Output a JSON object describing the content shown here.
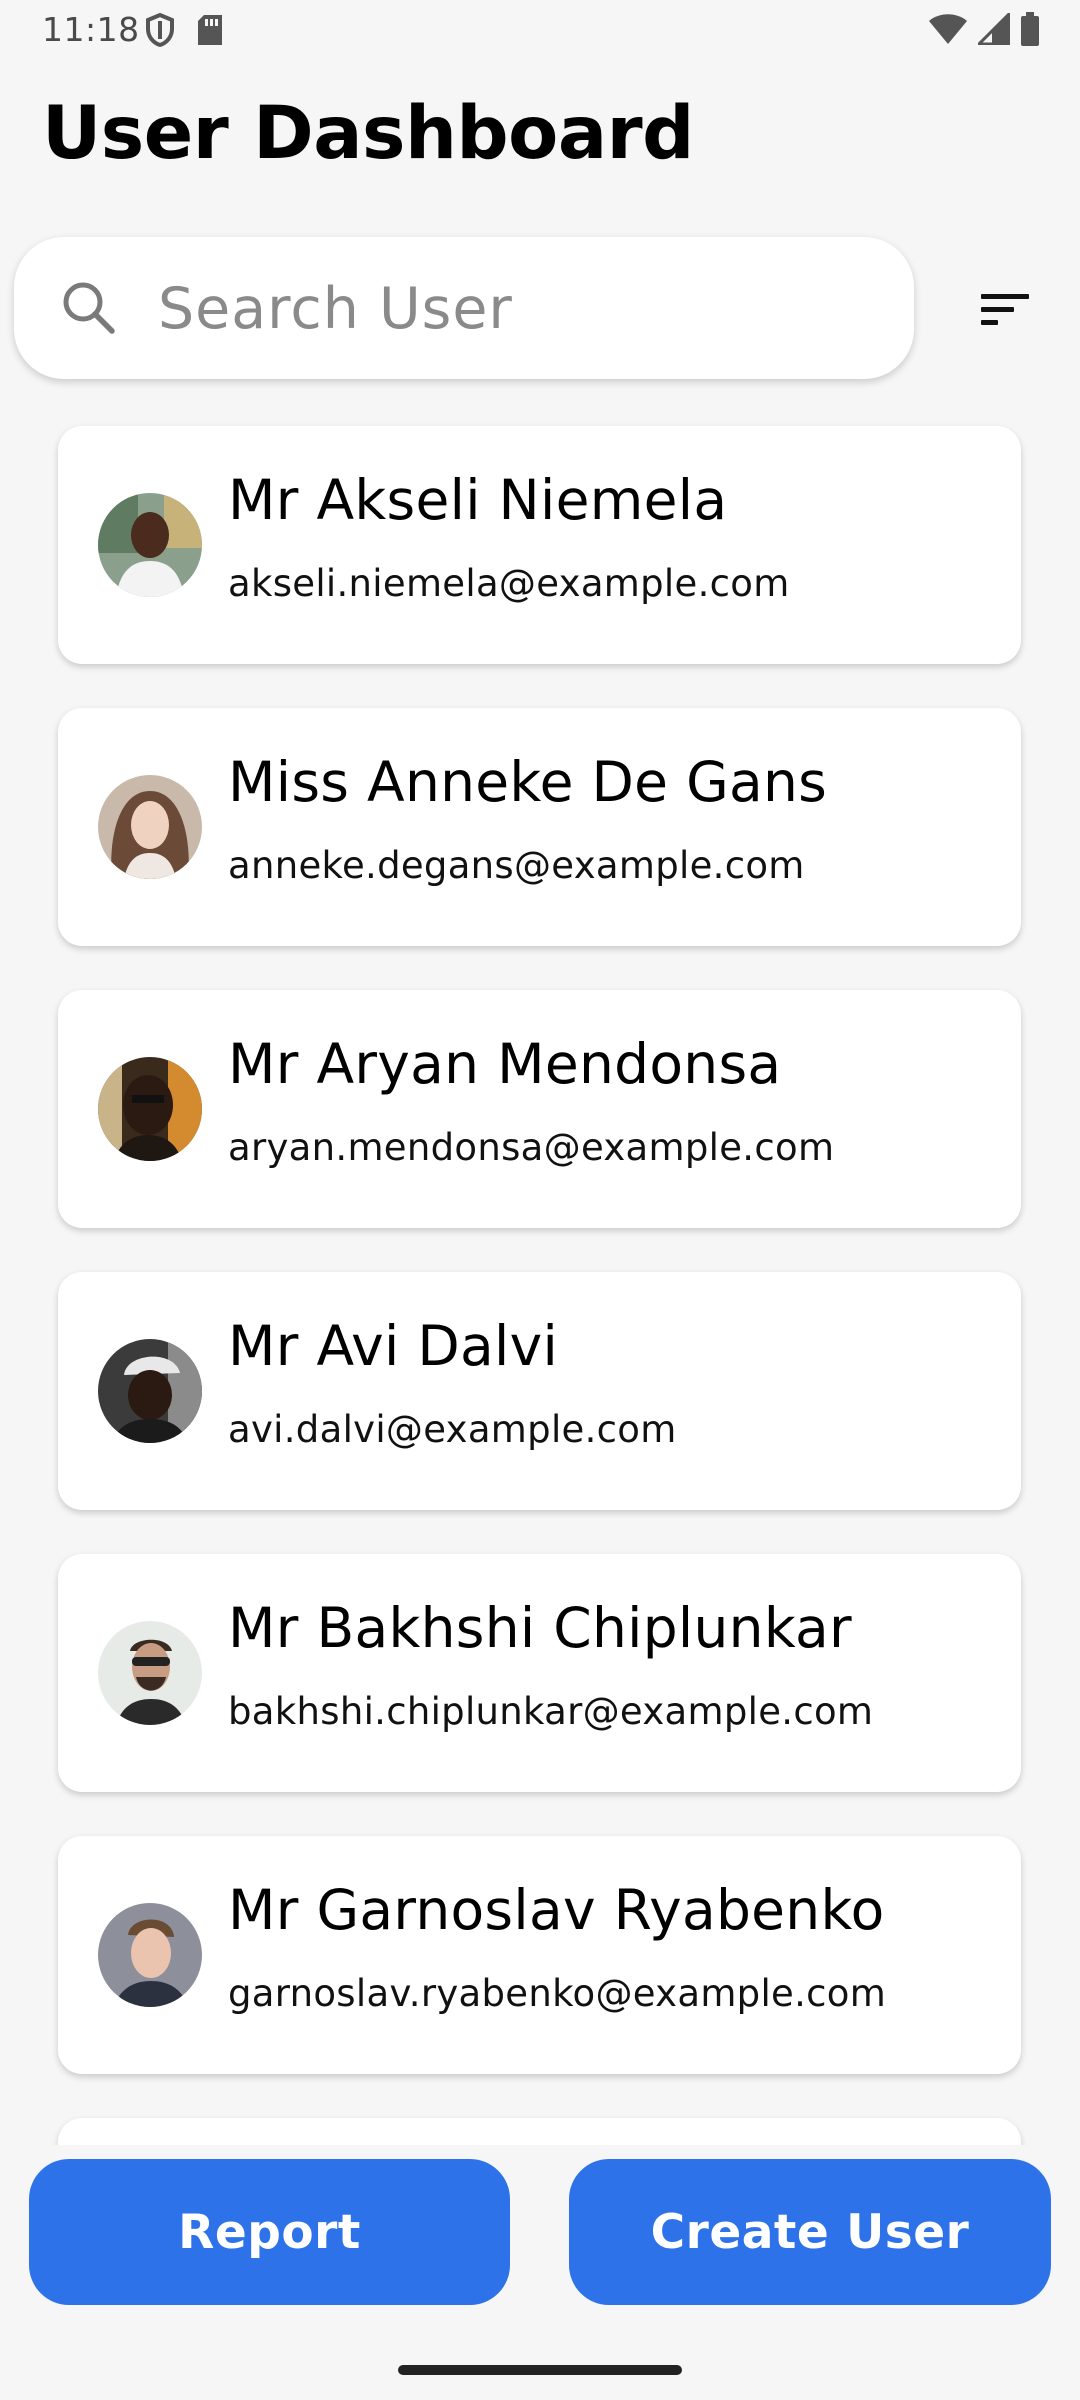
{
  "status_bar": {
    "time": "11:18",
    "left_icons": [
      "shield-icon",
      "sd-card-icon"
    ],
    "right_icons": [
      "wifi-icon",
      "signal-icon",
      "battery-icon"
    ]
  },
  "header": {
    "title": "User Dashboard"
  },
  "search": {
    "placeholder": "Search User",
    "value": ""
  },
  "filter": {
    "icon": "sort-icon"
  },
  "users": [
    {
      "name": "Mr Akseli Niemela",
      "email": "akseli.niemela@example.com"
    },
    {
      "name": "Miss Anneke De Gans",
      "email": "anneke.degans@example.com"
    },
    {
      "name": "Mr Aryan Mendonsa",
      "email": "aryan.mendonsa@example.com"
    },
    {
      "name": "Mr Avi Dalvi",
      "email": "avi.dalvi@example.com"
    },
    {
      "name": "Mr Bakhshi Chiplunkar",
      "email": "bakhshi.chiplunkar@example.com"
    },
    {
      "name": "Mr Garnoslav Ryabenko",
      "email": "garnoslav.ryabenko@example.com"
    }
  ],
  "actions": {
    "report_label": "Report",
    "create_label": "Create User"
  },
  "colors": {
    "accent": "#2e72ea",
    "background": "#f6f6f6",
    "card": "#ffffff"
  }
}
